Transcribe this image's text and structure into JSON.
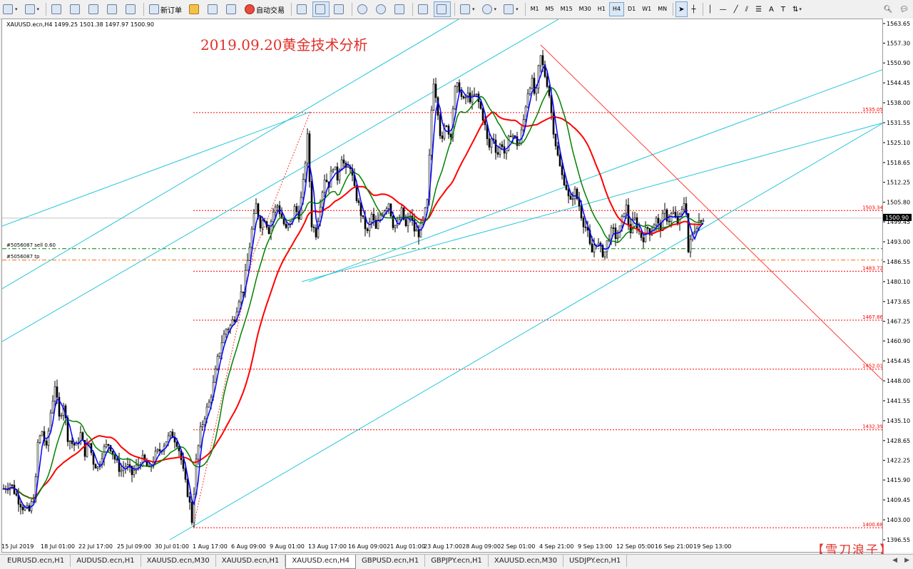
{
  "toolbar": {
    "new_order_label": "新订单",
    "autotrading_label": "自动交易",
    "timeframes": [
      "M1",
      "M5",
      "M15",
      "M30",
      "H1",
      "H4",
      "D1",
      "W1",
      "MN"
    ],
    "active_timeframe": "H4"
  },
  "chart_window": {
    "symbol_info": "XAUUSD.ecn,H4  1499.25 1501.38 1497.97 1500.90",
    "title_overlay": "2019.09.20黄金技术分析",
    "brand": "【雪刀浪子】",
    "current_price": "1500.90",
    "order_sell_label": "#5056087 sell 0.60",
    "order_tp_label": "#5056087 tp",
    "level_labels": [
      "1535.05",
      "1503.34",
      "1483.72",
      "1467.86",
      "1452.01",
      "1432.39",
      "1400.68"
    ],
    "price_ticks": [
      "1563.65",
      "1557.30",
      "1550.90",
      "1544.45",
      "1538.00",
      "1531.55",
      "1525.10",
      "1518.65",
      "1512.25",
      "1505.80",
      "1499.45",
      "1493.00",
      "1486.55",
      "1480.10",
      "1473.65",
      "1467.25",
      "1460.90",
      "1454.45",
      "1448.00",
      "1441.55",
      "1435.10",
      "1428.65",
      "1422.25",
      "1415.90",
      "1409.45",
      "1403.00",
      "1396.55"
    ],
    "time_ticks": [
      "15 Jul 2019",
      "18 Jul 01:00",
      "22 Jul 17:00",
      "25 Jul 09:00",
      "30 Jul 01:00",
      "1 Aug 17:00",
      "6 Aug 09:00",
      "9 Aug 01:00",
      "13 Aug 17:00",
      "16 Aug 09:00",
      "21 Aug 01:00",
      "23 Aug 17:00",
      "28 Aug 09:00",
      "2 Sep 01:00",
      "4 Sep 21:00",
      "9 Sep 13:00",
      "12 Sep 05:00",
      "16 Sep 21:00",
      "19 Sep 13:00"
    ]
  },
  "chart_data": {
    "type": "candlestick",
    "symbol": "XAUUSD.ecn",
    "timeframe": "H4",
    "ylim": [
      1396.55,
      1563.65
    ],
    "horizontal_levels": [
      1535.05,
      1503.34,
      1483.72,
      1467.86,
      1452.01,
      1432.39,
      1400.68
    ],
    "order_levels": {
      "sell": 1491.0,
      "tp": 1487.3
    },
    "last_price": 1500.9,
    "close_path": [
      [
        0,
        1413
      ],
      [
        12,
        1415
      ],
      [
        22,
        1410
      ],
      [
        30,
        1407
      ],
      [
        38,
        1406
      ],
      [
        46,
        1412
      ],
      [
        50,
        1428
      ],
      [
        56,
        1432
      ],
      [
        62,
        1426
      ],
      [
        68,
        1438
      ],
      [
        74,
        1447
      ],
      [
        80,
        1436
      ],
      [
        86,
        1441
      ],
      [
        92,
        1430
      ],
      [
        98,
        1428
      ],
      [
        104,
        1427
      ],
      [
        110,
        1431
      ],
      [
        116,
        1425
      ],
      [
        122,
        1428
      ],
      [
        128,
        1422
      ],
      [
        134,
        1420
      ],
      [
        142,
        1426
      ],
      [
        150,
        1428
      ],
      [
        158,
        1423
      ],
      [
        166,
        1419
      ],
      [
        174,
        1421
      ],
      [
        182,
        1418
      ],
      [
        190,
        1421
      ],
      [
        198,
        1423
      ],
      [
        206,
        1419
      ],
      [
        214,
        1424
      ],
      [
        222,
        1426
      ],
      [
        230,
        1429
      ],
      [
        238,
        1431
      ],
      [
        246,
        1428
      ],
      [
        250,
        1424
      ],
      [
        256,
        1416
      ],
      [
        262,
        1410
      ],
      [
        266,
        1403
      ],
      [
        272,
        1422
      ],
      [
        278,
        1432
      ],
      [
        284,
        1437
      ],
      [
        290,
        1441
      ],
      [
        296,
        1447
      ],
      [
        302,
        1455
      ],
      [
        308,
        1461
      ],
      [
        314,
        1465
      ],
      [
        320,
        1466
      ],
      [
        326,
        1469
      ],
      [
        332,
        1475
      ],
      [
        338,
        1478
      ],
      [
        344,
        1487
      ],
      [
        350,
        1497
      ],
      [
        356,
        1505
      ],
      [
        362,
        1499
      ],
      [
        368,
        1501
      ],
      [
        374,
        1497
      ],
      [
        380,
        1503
      ],
      [
        386,
        1505
      ],
      [
        392,
        1501
      ],
      [
        398,
        1497
      ],
      [
        404,
        1499
      ],
      [
        410,
        1504
      ],
      [
        416,
        1502
      ],
      [
        422,
        1512
      ],
      [
        428,
        1527
      ],
      [
        434,
        1499
      ],
      [
        440,
        1496
      ],
      [
        446,
        1506
      ],
      [
        452,
        1514
      ],
      [
        458,
        1512
      ],
      [
        464,
        1518
      ],
      [
        470,
        1514
      ],
      [
        476,
        1521
      ],
      [
        482,
        1516
      ],
      [
        488,
        1518
      ],
      [
        494,
        1510
      ],
      [
        500,
        1505
      ],
      [
        506,
        1500
      ],
      [
        512,
        1496
      ],
      [
        518,
        1502
      ],
      [
        524,
        1497
      ],
      [
        530,
        1502
      ],
      [
        536,
        1504
      ],
      [
        542,
        1506
      ],
      [
        548,
        1499
      ],
      [
        554,
        1498
      ],
      [
        560,
        1503
      ],
      [
        566,
        1498
      ],
      [
        572,
        1502
      ],
      [
        578,
        1497
      ],
      [
        584,
        1496
      ],
      [
        590,
        1500
      ],
      [
        596,
        1506
      ],
      [
        600,
        1525
      ],
      [
        604,
        1547
      ],
      [
        610,
        1538
      ],
      [
        616,
        1524
      ],
      [
        622,
        1533
      ],
      [
        628,
        1526
      ],
      [
        634,
        1542
      ],
      [
        640,
        1544
      ],
      [
        646,
        1538
      ],
      [
        652,
        1541
      ],
      [
        658,
        1539
      ],
      [
        664,
        1541
      ],
      [
        670,
        1537
      ],
      [
        676,
        1532
      ],
      [
        682,
        1523
      ],
      [
        688,
        1528
      ],
      [
        694,
        1521
      ],
      [
        700,
        1526
      ],
      [
        706,
        1520
      ],
      [
        712,
        1529
      ],
      [
        718,
        1527
      ],
      [
        724,
        1524
      ],
      [
        730,
        1531
      ],
      [
        736,
        1541
      ],
      [
        742,
        1546
      ],
      [
        748,
        1539
      ],
      [
        754,
        1554
      ],
      [
        760,
        1548
      ],
      [
        766,
        1543
      ],
      [
        772,
        1531
      ],
      [
        778,
        1522
      ],
      [
        784,
        1515
      ],
      [
        790,
        1512
      ],
      [
        796,
        1505
      ],
      [
        802,
        1510
      ],
      [
        808,
        1506
      ],
      [
        814,
        1500
      ],
      [
        820,
        1497
      ],
      [
        826,
        1489
      ],
      [
        832,
        1494
      ],
      [
        838,
        1491
      ],
      [
        844,
        1489
      ],
      [
        850,
        1495
      ],
      [
        856,
        1497
      ],
      [
        862,
        1494
      ],
      [
        868,
        1499
      ],
      [
        874,
        1506
      ],
      [
        880,
        1496
      ],
      [
        886,
        1501
      ],
      [
        892,
        1497
      ],
      [
        898,
        1494
      ],
      [
        904,
        1498
      ],
      [
        910,
        1496
      ],
      [
        916,
        1501
      ],
      [
        922,
        1497
      ],
      [
        928,
        1503
      ],
      [
        934,
        1500
      ],
      [
        940,
        1503
      ],
      [
        946,
        1499
      ],
      [
        952,
        1502
      ],
      [
        958,
        1508
      ],
      [
        962,
        1490
      ],
      [
        968,
        1496
      ],
      [
        974,
        1499
      ],
      [
        980,
        1501
      ],
      [
        984,
        1501
      ]
    ],
    "ma_fast": {
      "name": "MA fast",
      "color": "#0000ff"
    },
    "ma_medium": {
      "name": "MA medium",
      "color": "#008000"
    },
    "ma_slow": {
      "name": "MA slow",
      "color": "#ff0000"
    }
  },
  "tabs": [
    {
      "label": "EURUSD.ecn,H1",
      "active": false
    },
    {
      "label": "AUDUSD.ecn,H1",
      "active": false
    },
    {
      "label": "XAUUSD.ecn,M30",
      "active": false
    },
    {
      "label": "XAUUSD.ecn,H1",
      "active": false
    },
    {
      "label": "XAUUSD.ecn,H4",
      "active": true
    },
    {
      "label": "GBPUSD.ecn,H1",
      "active": false
    },
    {
      "label": "GBPJPY.ecn,H1",
      "active": false
    },
    {
      "label": "XAUUSD.ecn,M30",
      "active": false
    },
    {
      "label": "USDJPY.ecn,H1",
      "active": false
    }
  ]
}
